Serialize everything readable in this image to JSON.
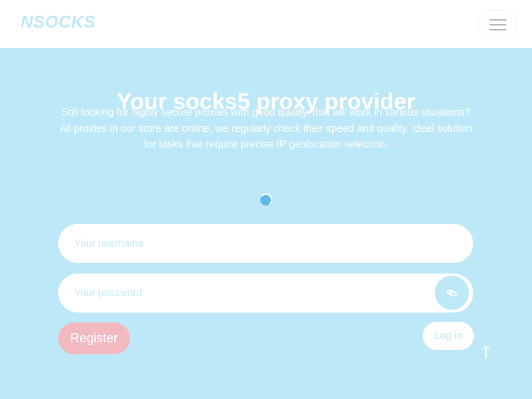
{
  "header": {
    "logo": "NSOCKS",
    "menu_icon": "hamburger-menu-icon"
  },
  "hero": {
    "title": "Your socks5 proxy provider",
    "description": "Still looking for highly secure proxies with good quality, that will work in various situations? All proxies in our store are online, we regularly check their speed and quality. Ideal solution for tasks that require precise IP geolocation selection."
  },
  "loader_icon": "spinner-icon",
  "form": {
    "username_placeholder": "Your username",
    "password_placeholder": "Your password",
    "show_password_icon": "eye-icon",
    "register_label": "Register",
    "login_label": "Log in"
  },
  "scroll_top_icon": "arrow-up-icon",
  "colors": {
    "hero_bg": "#bde8f8",
    "logo": "#bfe8f7",
    "register_bg": "#f2b9c1",
    "header_bg": "#ffffff"
  }
}
